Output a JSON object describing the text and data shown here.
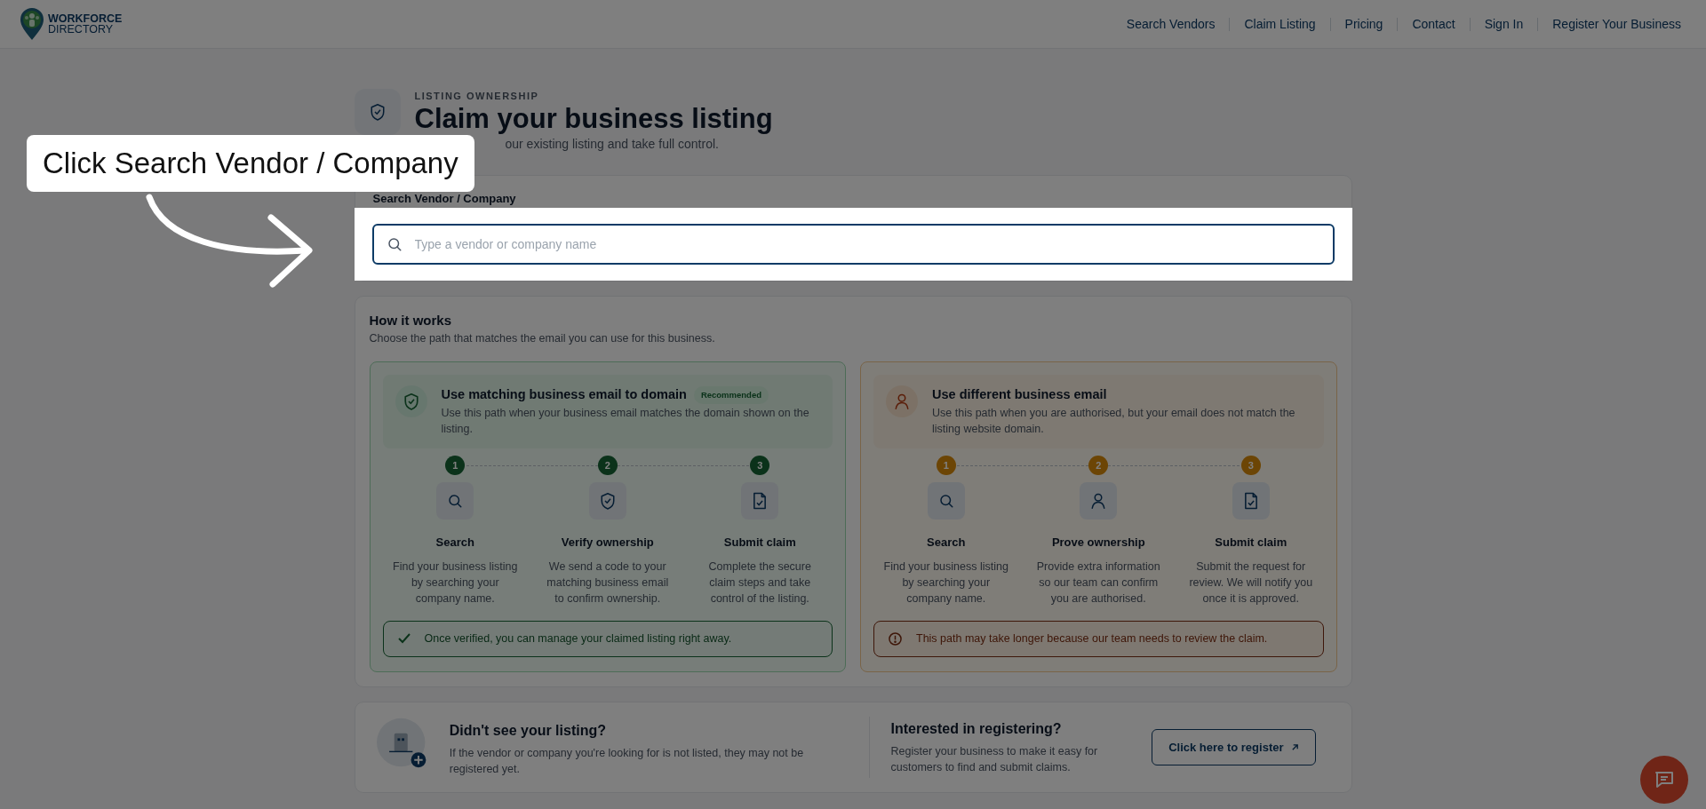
{
  "header": {
    "logo": {
      "line1": "WORKFORCE",
      "line2": "DIRECTORY"
    },
    "nav": [
      "Search Vendors",
      "Claim Listing",
      "Pricing",
      "Contact",
      "Sign In",
      "Register Your Business"
    ]
  },
  "hero": {
    "eyebrow": "LISTING OWNERSHIP",
    "title": "Claim your business listing",
    "subtitle": "our existing listing and take full control."
  },
  "search": {
    "label": "Search Vendor / Company",
    "placeholder": "Type a vendor or company name"
  },
  "how_it_works": {
    "title": "How it works",
    "subtitle": "Choose the path that matches the email you can use for this business.",
    "paths": [
      {
        "kind": "recommended",
        "title": "Use matching business email to domain",
        "badge": "Recommended",
        "description": "Use this path when your business email matches the domain shown on the listing.",
        "steps": [
          {
            "kind": "search",
            "number": "1",
            "title": "Search",
            "text": "Find your business listing by searching your company name."
          },
          {
            "kind": "verify",
            "number": "2",
            "title": "Verify ownership",
            "text": "We send a code to your matching business email to confirm ownership."
          },
          {
            "kind": "submit",
            "number": "3",
            "title": "Submit claim",
            "text": "Complete the secure claim steps and take control of the listing."
          }
        ],
        "note": "Once verified, you can manage your claimed listing right away."
      },
      {
        "kind": "review",
        "title": "Use different business email",
        "description": "Use this path when you are authorised, but your email does not match the listing website domain.",
        "steps": [
          {
            "kind": "search",
            "number": "1",
            "title": "Search",
            "text": "Find your business listing by searching your company name."
          },
          {
            "kind": "person",
            "number": "2",
            "title": "Prove ownership",
            "text": "Provide extra information so our team can confirm you are authorised."
          },
          {
            "kind": "submit",
            "number": "3",
            "title": "Submit claim",
            "text": "Submit the request for review. We will notify you once it is approved."
          }
        ],
        "note": "This path may take longer because our team needs to review the claim."
      }
    ]
  },
  "not_listed": {
    "title": "Didn't see your listing?",
    "text": "If the vendor or company you're looking for is not listed, they may not be registered yet."
  },
  "register": {
    "title": "Interested in registering?",
    "text": "Register your business to make it easy for customers to find and submit claims.",
    "button": "Click here to register"
  },
  "callout": {
    "text": "Click Search Vendor / Company"
  }
}
